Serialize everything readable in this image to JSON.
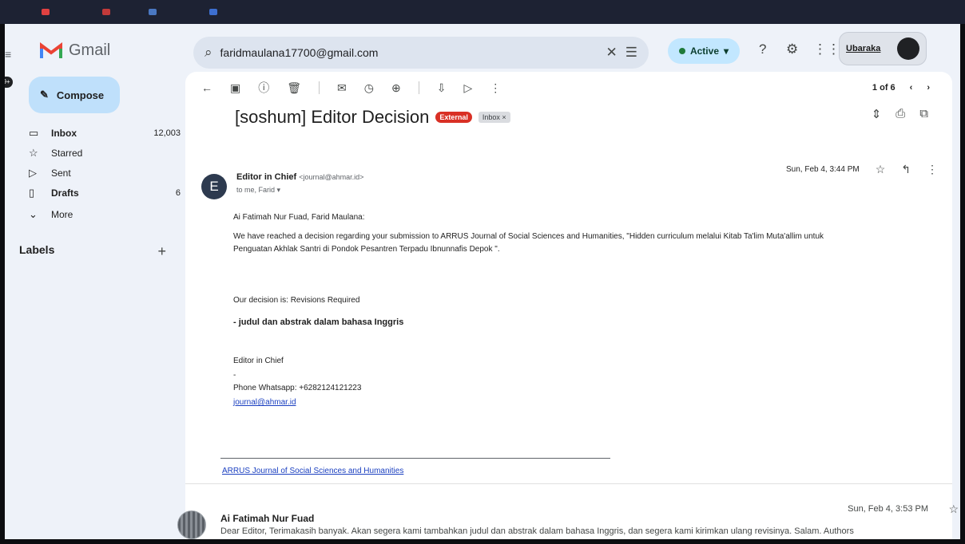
{
  "header": {
    "app_name": "Gmail",
    "search_value": "faridmaulana17700@gmail.com",
    "status": "Active",
    "account_label": "Ubaraka"
  },
  "sidebar": {
    "compose_label": "Compose",
    "items": [
      {
        "label": "Inbox",
        "count": "12,003",
        "icon": "inbox-icon"
      },
      {
        "label": "Starred",
        "count": "",
        "icon": "star-icon"
      },
      {
        "label": "Sent",
        "count": "",
        "icon": "send-icon"
      },
      {
        "label": "Drafts",
        "count": "6",
        "icon": "draft-icon"
      },
      {
        "label": "More",
        "count": "",
        "icon": "chevron-down-icon"
      }
    ],
    "labels_header": "Labels",
    "labels_add": "+"
  },
  "pager": {
    "text": "1 of 6"
  },
  "email": {
    "subject": "[soshum] Editor Decision",
    "tag_external": "External",
    "tag_inbox": "Inbox ×",
    "sender_name": "Editor in Chief",
    "sender_email": "<journal@ahmar.id>",
    "to_line": "to me, Farid ▾",
    "timestamp": "Sun, Feb 4, 3:44 PM",
    "avatar_letter": "E",
    "body": {
      "greeting": "Ai Fatimah Nur Fuad, Farid Maulana:",
      "para1_line1": "We have reached a decision regarding your submission to ARRUS Journal of Social Sciences and Humanities, \"Hidden curriculum melalui Kitab Ta'lim Muta'allim untuk",
      "para1_line2": "Penguatan Akhlak Santri di Pondok Pesantren Terpadu Ibnunnafis Depok \".",
      "decision": "Our decision is: Revisions Required",
      "note": "- judul dan abstrak dalam bahasa Inggris",
      "sig_title": "Editor in Chief",
      "sig_dash": "-",
      "sig_phone": "Phone Whatsapp: +6282124121223",
      "sig_email": "journal@ahmar.id",
      "footer_link": "ARRUS Journal of Social Sciences and Humanities"
    }
  },
  "reply": {
    "sender": "Ai Fatimah Nur Fuad",
    "snippet": "Dear Editor, Terimakasih banyak. Akan segera kami tambahkan judul dan abstrak dalam bahasa Inggris, dan segera kami kirimkan ulang revisinya. Salam. Authors",
    "timestamp": "Sun, Feb 4, 3:53 PM"
  },
  "colors": {
    "accent": "#c2e7ff",
    "compose_bg": "#bfe0fb",
    "external_tag": "#d93025",
    "link": "#1a3fc0"
  }
}
